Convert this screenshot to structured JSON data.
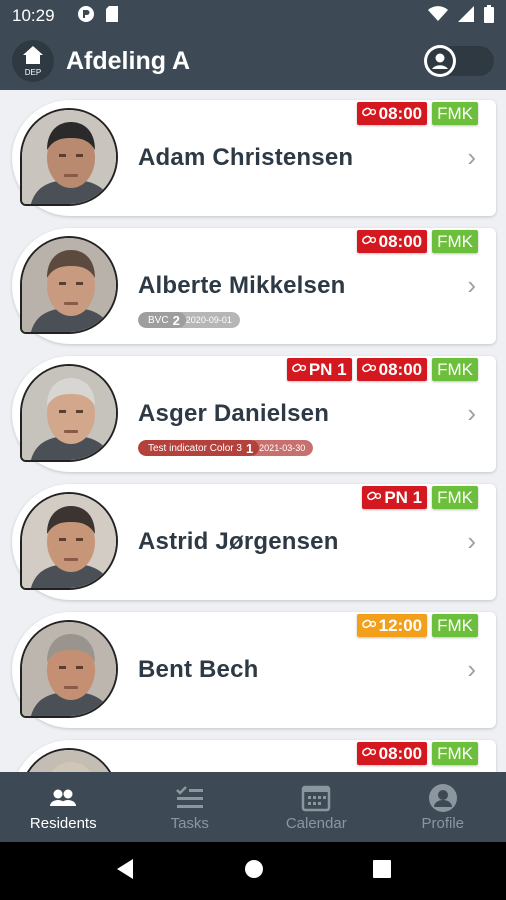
{
  "status_bar": {
    "time": "10:29"
  },
  "app_bar": {
    "dep_label": "DEP",
    "title": "Afdeling A"
  },
  "residents": [
    {
      "name": "Adam Christensen",
      "badges": [
        {
          "text": "08:00",
          "color": "red",
          "icon": "pill-icon"
        },
        {
          "text": "FMK",
          "color": "green"
        }
      ]
    },
    {
      "name": "Alberte Mikkelsen",
      "badges": [
        {
          "text": "08:00",
          "color": "red",
          "icon": "pill-icon"
        },
        {
          "text": "FMK",
          "color": "green"
        }
      ],
      "indicator": {
        "label": "BVC",
        "count": "2",
        "date": "2020-09-01",
        "color": "#9e9e9e"
      }
    },
    {
      "name": "Asger Danielsen",
      "badges": [
        {
          "text": "PN 1",
          "color": "red",
          "icon": "pill-icon"
        },
        {
          "text": "08:00",
          "color": "red",
          "icon": "pill-icon"
        },
        {
          "text": "FMK",
          "color": "green"
        }
      ],
      "indicator": {
        "label": "Test indicator Color 3",
        "count": "1",
        "date": "2021-03-30",
        "color": "#b5413d"
      }
    },
    {
      "name": "Astrid Jørgensen",
      "badges": [
        {
          "text": "PN 1",
          "color": "red",
          "icon": "pill-icon"
        },
        {
          "text": "FMK",
          "color": "green"
        }
      ]
    },
    {
      "name": "Bent Bech",
      "badges": [
        {
          "text": "12:00",
          "color": "orange",
          "icon": "pill-icon"
        },
        {
          "text": "FMK",
          "color": "green"
        }
      ]
    },
    {
      "name": "",
      "badges": [
        {
          "text": "08:00",
          "color": "red",
          "icon": "pill-icon"
        },
        {
          "text": "FMK",
          "color": "green"
        }
      ]
    }
  ],
  "bottom_nav": [
    {
      "label": "Residents",
      "icon": "residents-icon",
      "active": true
    },
    {
      "label": "Tasks",
      "icon": "tasks-icon",
      "active": false
    },
    {
      "label": "Calendar",
      "icon": "calendar-icon",
      "active": false
    },
    {
      "label": "Profile",
      "icon": "profile-icon",
      "active": false
    }
  ],
  "colors": {
    "appbar": "#3d4a55",
    "red": "#d3191f",
    "orange": "#f2a01c",
    "green": "#6cbf3a"
  }
}
